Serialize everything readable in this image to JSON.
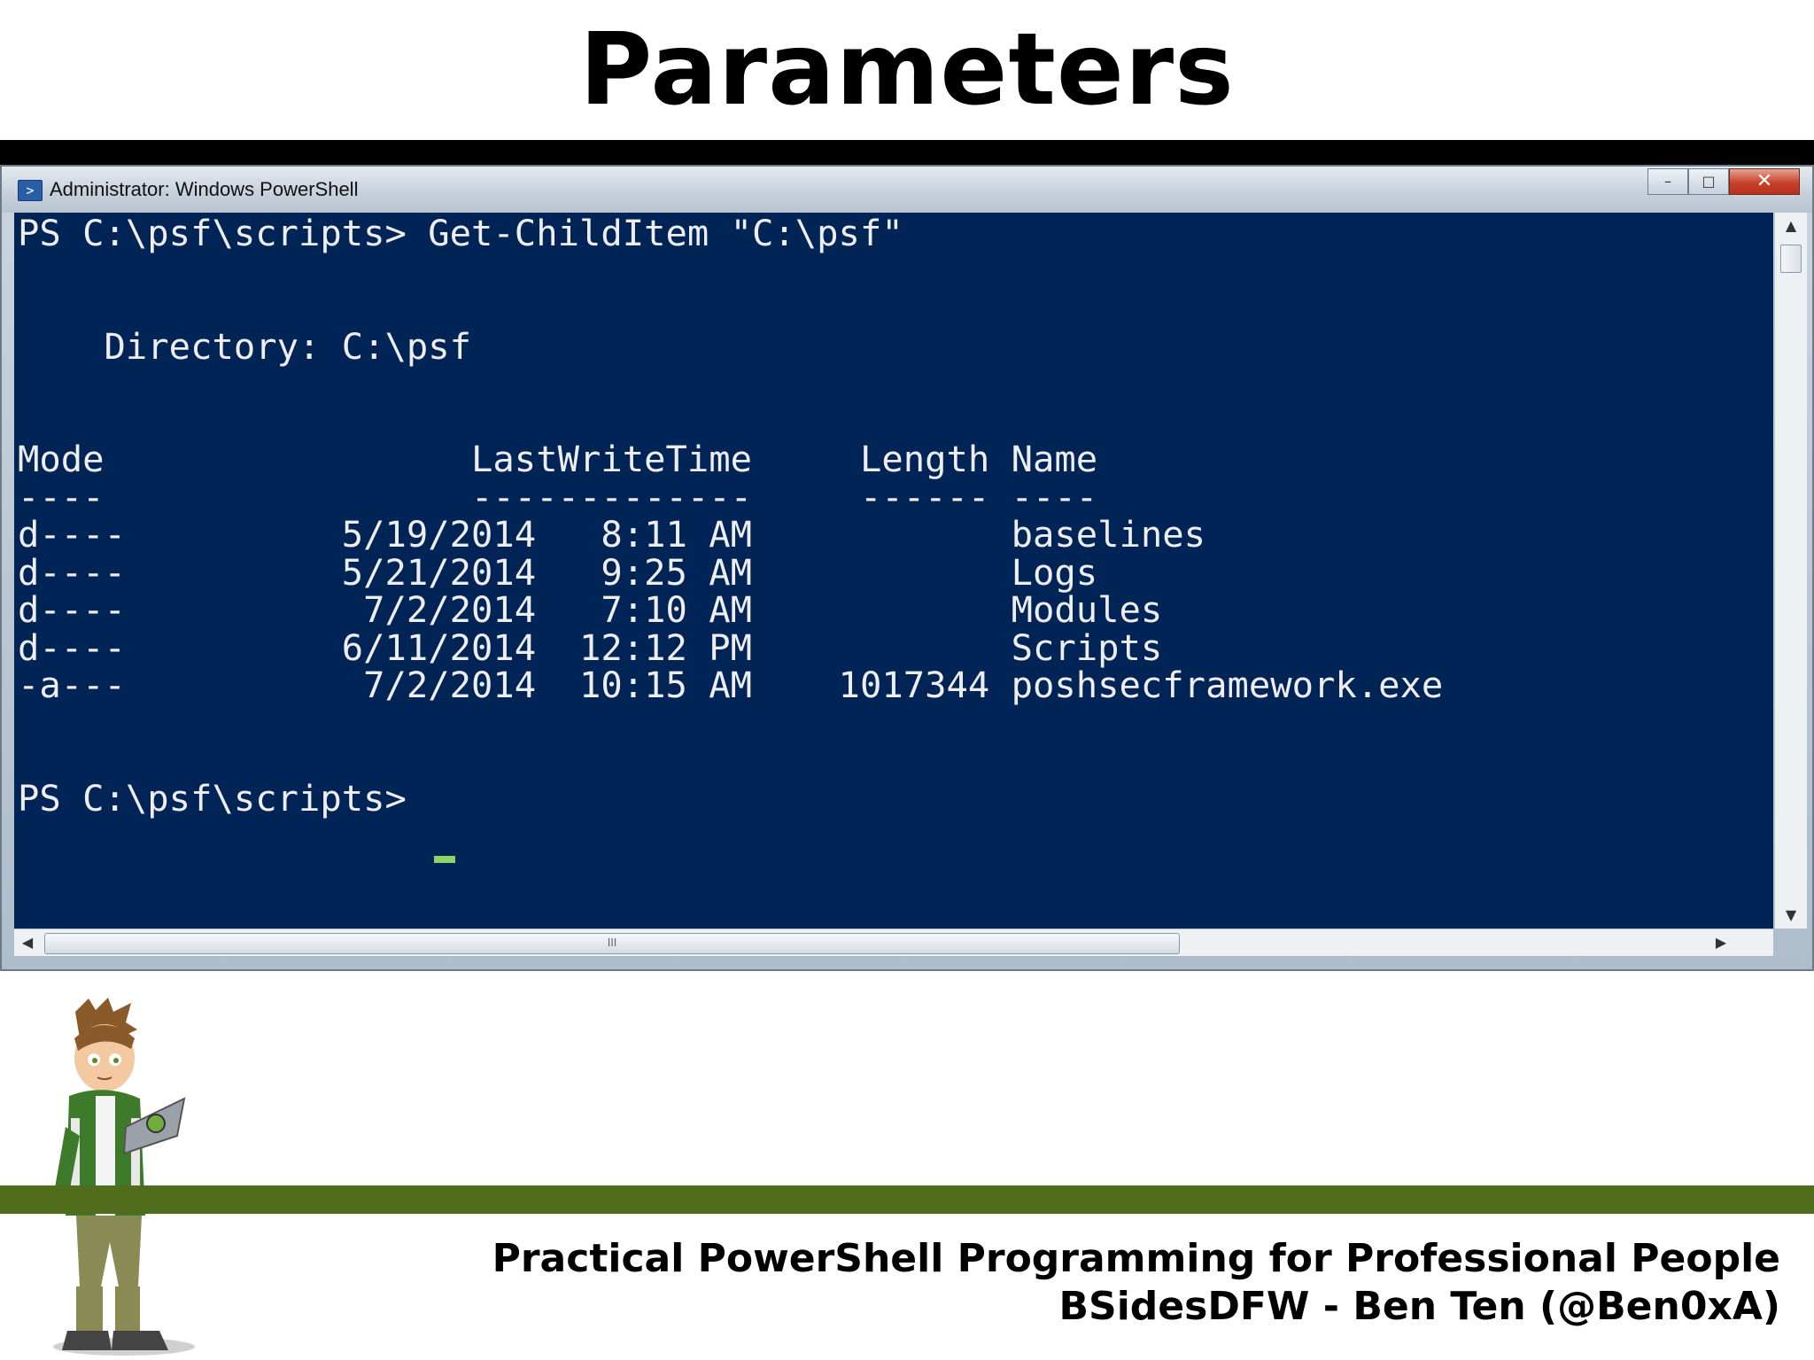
{
  "slide": {
    "title": "Parameters",
    "footer_line1": "Practical PowerShell Programming for Professional People",
    "footer_line2": "BSidesDFW - Ben Ten (@Ben0xA)"
  },
  "window": {
    "title": "Administrator: Windows PowerShell",
    "minimize_symbol": "–",
    "maximize_symbol": "□",
    "close_symbol": "✕",
    "scroll_grip": "III"
  },
  "console": {
    "command_line": "PS C:\\psf\\scripts> Get-ChildItem \"C:\\psf\"",
    "directory_line": "    Directory: C:\\psf",
    "headers": {
      "mode": "Mode",
      "lastwritetime": "LastWriteTime",
      "length": "Length",
      "name": "Name"
    },
    "separators": {
      "mode": "----",
      "lastwritetime": "-------------",
      "length": "------",
      "name": "----"
    },
    "rows": [
      {
        "mode": "d----",
        "date": "5/19/2014",
        "time": "8:11 AM",
        "length": "",
        "name": "baselines"
      },
      {
        "mode": "d----",
        "date": "5/21/2014",
        "time": "9:25 AM",
        "length": "",
        "name": "Logs"
      },
      {
        "mode": "d----",
        "date": "7/2/2014",
        "time": "7:10 AM",
        "length": "",
        "name": "Modules"
      },
      {
        "mode": "d----",
        "date": "6/11/2014",
        "time": "12:12 PM",
        "length": "",
        "name": "Scripts"
      },
      {
        "mode": "-a---",
        "date": "7/2/2014",
        "time": "10:15 AM",
        "length": "1017344",
        "name": "poshsecframework.exe"
      }
    ],
    "prompt": "PS C:\\psf\\scripts> "
  },
  "colors": {
    "console_background": "#012456",
    "console_text": "#eeedf0",
    "cursor": "#8fd36b",
    "footer_bar": "#4f6d1c"
  }
}
